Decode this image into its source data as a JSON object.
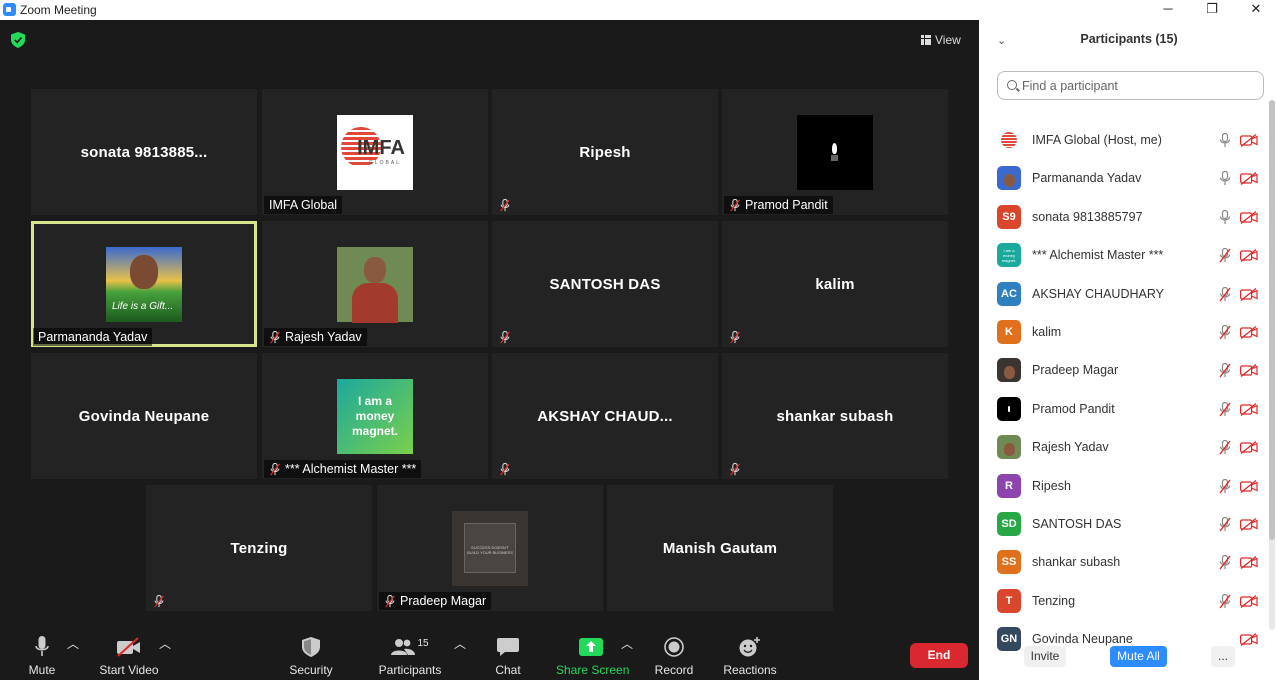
{
  "window": {
    "title": "Zoom Meeting",
    "minimize": "─",
    "restore": "❐",
    "close": "✕"
  },
  "meeting": {
    "view_label": "View",
    "tiles": [
      {
        "display": "sonata 9813885...",
        "tag": ""
      },
      {
        "display": "",
        "tag": "IMFA Global",
        "pic": "imfa",
        "muted": false
      },
      {
        "display": "Ripesh",
        "tag": "",
        "muted": true
      },
      {
        "display": "",
        "tag": "Pramod Pandit",
        "pic": "candle",
        "muted": true
      },
      {
        "display": "",
        "tag": "Parmananda Yadav",
        "pic": "parma",
        "muted": false
      },
      {
        "display": "",
        "tag": "Rajesh Yadav",
        "pic": "rajesh",
        "muted": true
      },
      {
        "display": "SANTOSH DAS",
        "tag": "",
        "muted": true
      },
      {
        "display": "kalim",
        "tag": "",
        "muted": true
      },
      {
        "display": "Govinda Neupane",
        "tag": ""
      },
      {
        "display": "",
        "tag": "*** Alchemist Master ***",
        "pic": "magnet",
        "muted": true
      },
      {
        "display": "AKSHAY  CHAUD...",
        "tag": "",
        "muted": true
      },
      {
        "display": "shankar subash",
        "tag": "",
        "muted": true
      },
      {
        "display": "Tenzing",
        "tag": "",
        "muted": true
      },
      {
        "display": "",
        "tag": "Pradeep Magar",
        "pic": "pradeep",
        "muted": true
      },
      {
        "display": "Manish Gautam",
        "tag": ""
      }
    ],
    "imfa_logo": {
      "text": "IMFA",
      "sub": "GLOBAL"
    },
    "parma_caption": "Life is a Gift...",
    "magnet_text": "I am a money magnet.",
    "pradeep_pic_text": "SUCCESS DOESN'T BUILD YOUR BUSINESS"
  },
  "toolbar": {
    "mute": "Mute",
    "start_video": "Start Video",
    "security": "Security",
    "participants": "Participants",
    "participants_count": "15",
    "chat": "Chat",
    "share_screen": "Share Screen",
    "record": "Record",
    "reactions": "Reactions",
    "end": "End",
    "share_color": "#23d959",
    "end_color": "#d9282f"
  },
  "panel": {
    "title": "Participants (15)",
    "search_placeholder": "Find a participant",
    "participants": [
      {
        "name": "IMFA Global (Host, me)",
        "initials": "",
        "color": "#ffffff",
        "mic_on": true,
        "avatar": "imfa"
      },
      {
        "name": "Parmananda Yadav",
        "initials": "",
        "color": "#3a6ad0",
        "mic_on": true,
        "avatar": "photo"
      },
      {
        "name": "sonata 9813885797",
        "initials": "S9",
        "color": "#d9462b",
        "mic_on": true
      },
      {
        "name": "*** Alchemist Master ***",
        "initials": "",
        "color": "#1ba89d",
        "mic_on": false,
        "avatar": "magnet"
      },
      {
        "name": "AKSHAY CHAUDHARY",
        "initials": "AC",
        "color": "#2f7fc1",
        "mic_on": false
      },
      {
        "name": "kalim",
        "initials": "K",
        "color": "#e0701c",
        "mic_on": false
      },
      {
        "name": "Pradeep Magar",
        "initials": "",
        "color": "#3a3530",
        "mic_on": false,
        "avatar": "photo"
      },
      {
        "name": "Pramod Pandit",
        "initials": "",
        "color": "#000000",
        "mic_on": false,
        "avatar": "candle"
      },
      {
        "name": "Rajesh Yadav",
        "initials": "",
        "color": "#6f8a52",
        "mic_on": false,
        "avatar": "photo"
      },
      {
        "name": "Ripesh",
        "initials": "R",
        "color": "#8e44ad",
        "mic_on": false
      },
      {
        "name": "SANTOSH DAS",
        "initials": "SD",
        "color": "#27a844",
        "mic_on": false
      },
      {
        "name": "shankar subash",
        "initials": "SS",
        "color": "#e0701c",
        "mic_on": false
      },
      {
        "name": "Tenzing",
        "initials": "T",
        "color": "#d9462b",
        "mic_on": false
      },
      {
        "name": "Govinda Neupane",
        "initials": "GN",
        "color": "#34495e",
        "mic_on": null
      }
    ],
    "invite": "Invite",
    "mute_all": "Mute All",
    "more": "..."
  }
}
